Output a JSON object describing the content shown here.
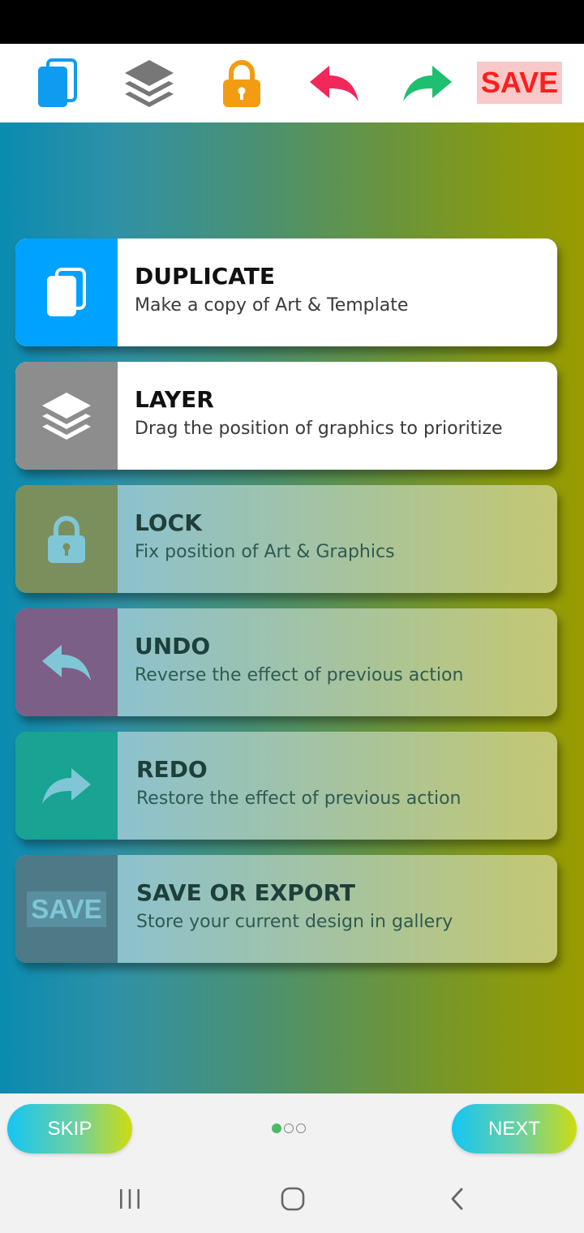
{
  "toolbar": {
    "icons": [
      "duplicate-icon",
      "layers-icon",
      "lock-icon",
      "undo-icon",
      "redo-icon"
    ],
    "save_label": "SAVE"
  },
  "cards": [
    {
      "id": "duplicate",
      "title": "DUPLICATE",
      "desc": "Make a copy of Art & Template",
      "icon": "duplicate-icon",
      "icon_color": "#00a2ff",
      "state": "active"
    },
    {
      "id": "layer",
      "title": "LAYER",
      "desc": "Drag the position of graphics to prioritize",
      "icon": "layers-icon",
      "icon_color": "#8d8d8d",
      "state": "active"
    },
    {
      "id": "lock",
      "title": "LOCK",
      "desc": "Fix position of Art & Graphics",
      "icon": "lock-icon",
      "icon_color": "#7b8f5c",
      "state": "faded"
    },
    {
      "id": "undo",
      "title": "UNDO",
      "desc": "Reverse the effect of previous action",
      "icon": "undo-icon",
      "icon_color": "#7c5f86",
      "state": "faded"
    },
    {
      "id": "redo",
      "title": "REDO",
      "desc": "Restore the effect of previous action",
      "icon": "redo-icon",
      "icon_color": "#18a392",
      "state": "faded"
    },
    {
      "id": "save",
      "title": "SAVE OR EXPORT",
      "desc": "Store your current design in gallery",
      "icon": "save-icon",
      "icon_color": "#4d7a86",
      "state": "faded",
      "icon_label": "SAVE"
    }
  ],
  "onboarding": {
    "skip_label": "SKIP",
    "next_label": "NEXT",
    "page": 1,
    "page_count": 3
  },
  "nav": [
    "recent-apps-icon",
    "home-icon",
    "back-icon"
  ]
}
